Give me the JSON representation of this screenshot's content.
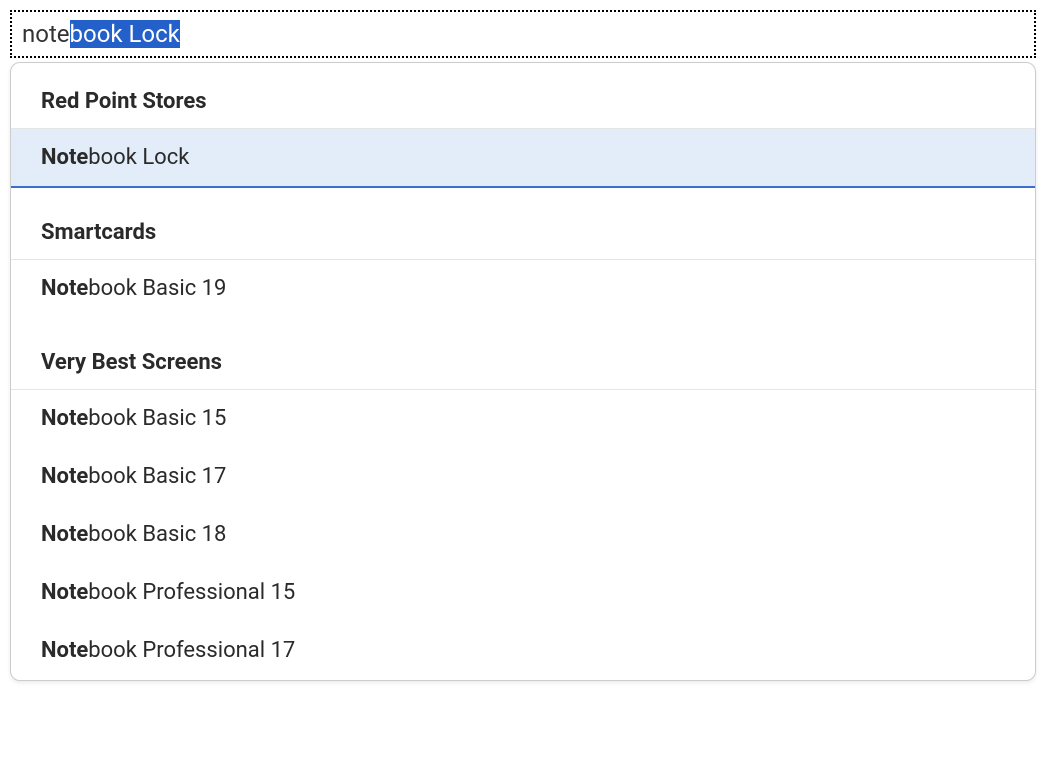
{
  "search": {
    "typed": "note",
    "selected_completion": "book Lock"
  },
  "dropdown": {
    "groups": [
      {
        "header": "Red Point Stores",
        "items": [
          {
            "match": "Note",
            "rest": "book Lock",
            "selected": true
          }
        ]
      },
      {
        "header": "Smartcards",
        "items": [
          {
            "match": "Note",
            "rest": "book Basic 19",
            "selected": false
          }
        ]
      },
      {
        "header": "Very Best Screens",
        "items": [
          {
            "match": "Note",
            "rest": "book Basic 15",
            "selected": false
          },
          {
            "match": "Note",
            "rest": "book Basic 17",
            "selected": false
          },
          {
            "match": "Note",
            "rest": "book Basic 18",
            "selected": false
          },
          {
            "match": "Note",
            "rest": "book Professional 15",
            "selected": false
          },
          {
            "match": "Note",
            "rest": "book Professional 17",
            "selected": false
          }
        ]
      }
    ]
  }
}
